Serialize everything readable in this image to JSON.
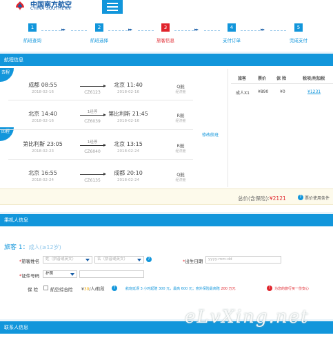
{
  "header": {
    "logo_cn": "中国南方航空",
    "logo_en": "CHINA SOUTHERN",
    "menu_icon": "hamburger-icon",
    "brand_color": "#1296db"
  },
  "steps": [
    {
      "num": "1",
      "label": "航班查询",
      "active": false
    },
    {
      "num": "2",
      "label": "航班选择",
      "active": false
    },
    {
      "num": "3",
      "label": "旅客信息",
      "active": true
    },
    {
      "num": "4",
      "label": "支付订单",
      "active": false
    },
    {
      "num": "5",
      "label": "完成支付",
      "active": false
    }
  ],
  "flight_section": {
    "title": "航程信息",
    "outbound_badge": "去程",
    "return_badge": "回程",
    "change_link": "修改航班",
    "flights": [
      {
        "dep": "成都  08:55",
        "dep_date": "2018-02-16",
        "stop": "",
        "flight_no": "CZ6123",
        "arr": "北京  11:40",
        "arr_date": "2018-02-16",
        "cabin": "Q舱",
        "cabin_note": "经济舱"
      },
      {
        "dep": "北京  14:40",
        "dep_date": "2018-02-16",
        "stop": "1经停",
        "flight_no": "CZ6039",
        "arr": "第比利斯  21:45",
        "arr_date": "2018-02-16",
        "cabin": "R舱",
        "cabin_note": "经济舱"
      },
      {
        "dep": "第比利斯  23:05",
        "dep_date": "2018-02-23",
        "stop": "1经停",
        "flight_no": "CZ6040",
        "arr": "北京  13:15",
        "arr_date": "2018-02-24",
        "cabin": "R舱",
        "cabin_note": "经济舱"
      },
      {
        "dep": "北京  16:55",
        "dep_date": "2018-02-24",
        "stop": "",
        "flight_no": "CZ6135",
        "arr": "成都  20:10",
        "arr_date": "2018-02-24",
        "cabin": "Q舱",
        "cabin_note": "经济舱"
      }
    ]
  },
  "price_table": {
    "headers": [
      "旅客",
      "票价",
      "保 险",
      "税项/附加税"
    ],
    "row": {
      "passenger": "成人X1",
      "fare": "¥890",
      "insurance": "¥0",
      "tax": "¥1231"
    }
  },
  "total": {
    "label": "总价(含保险):",
    "amount": "¥2121",
    "rules_label": "票价使用条件"
  },
  "passenger_section": {
    "title": "乘机人信息",
    "pax_title": "旅客 1：",
    "pax_type": "成人(≥12岁)",
    "name_label": "旅客姓名",
    "surname_placeholder": "姓（拼音或英文）",
    "given_placeholder": "名（拼音或英文）",
    "birth_label": "出生日期",
    "birth_placeholder": "yyyy-mm-dd",
    "id_label": "证件号码",
    "id_type": "护照",
    "insurance_label": "保  险",
    "insurance_option": "航空综合险",
    "insurance_price_prefix": "¥",
    "insurance_price_value": "30",
    "insurance_price_suffix": "/人/航段",
    "insurance_note_a": "航班延误 3 小时起赔 300 元，最高 600 元；意外保险最高赔 ",
    "insurance_note_b": "200 万元",
    "insurance_warn": "为您的旅行买一份安心"
  },
  "contact_section": {
    "title": "联系人信息"
  },
  "watermark": "eLvXing.net"
}
